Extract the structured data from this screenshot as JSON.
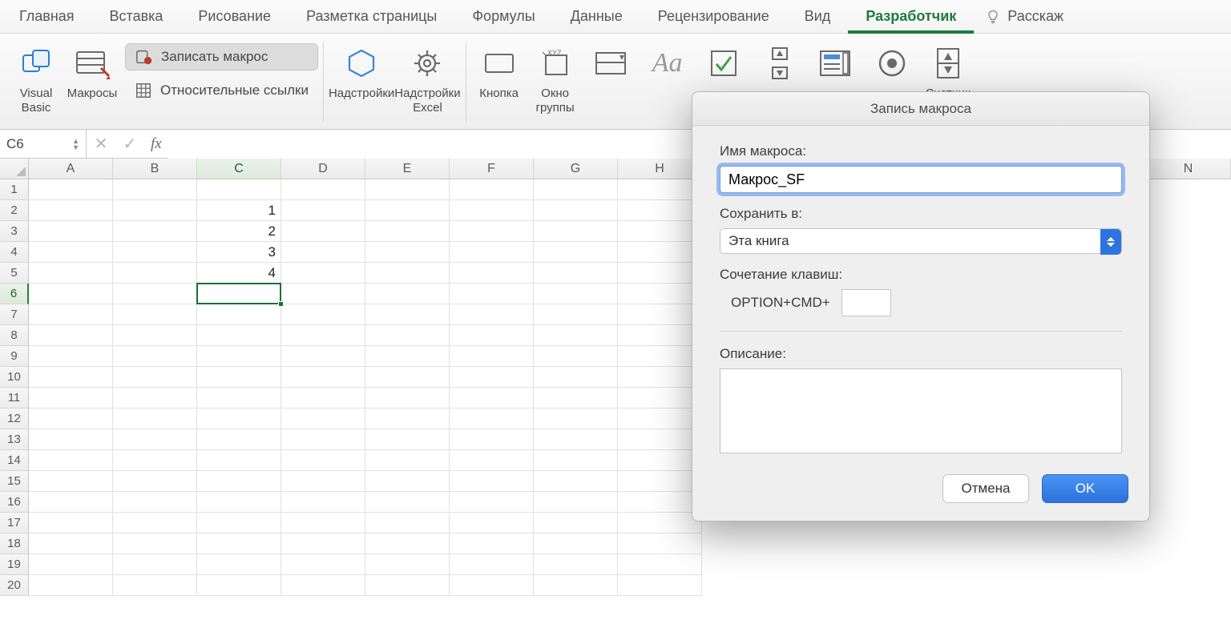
{
  "tabs": {
    "items": [
      "Главная",
      "Вставка",
      "Рисование",
      "Разметка страницы",
      "Формулы",
      "Данные",
      "Рецензирование",
      "Вид",
      "Разработчик"
    ],
    "active_index": 8,
    "tell_me": "Расскаж"
  },
  "ribbon": {
    "visual_basic": "Visual\nBasic",
    "macros": "Макросы",
    "record_macro": "Записать макрос",
    "relative_refs": "Относительные ссылки",
    "addins": "Надстройки",
    "excel_addins": "Надстройки\nExcel",
    "button_ctrl": "Кнопка",
    "group_window": "Окно\nгруппы",
    "counter": "Счетчик"
  },
  "formula_bar": {
    "name_box": "C6",
    "fx": "fx",
    "value": ""
  },
  "grid": {
    "columns": [
      "A",
      "B",
      "C",
      "D",
      "E",
      "F",
      "G",
      "H",
      "N"
    ],
    "row_count": 20,
    "selected_row": 6,
    "selected_col_index": 2,
    "data": {
      "C2": "1",
      "C3": "2",
      "C4": "3",
      "C5": "4"
    }
  },
  "dialog": {
    "title": "Запись макроса",
    "name_label": "Имя макроса:",
    "name_value": "Макрос_SF",
    "save_in_label": "Сохранить в:",
    "save_in_value": "Эта книга",
    "shortcut_label": "Сочетание клавиш:",
    "shortcut_prefix": "OPTION+CMD+",
    "description_label": "Описание:",
    "cancel": "Отмена",
    "ok": "OK"
  }
}
